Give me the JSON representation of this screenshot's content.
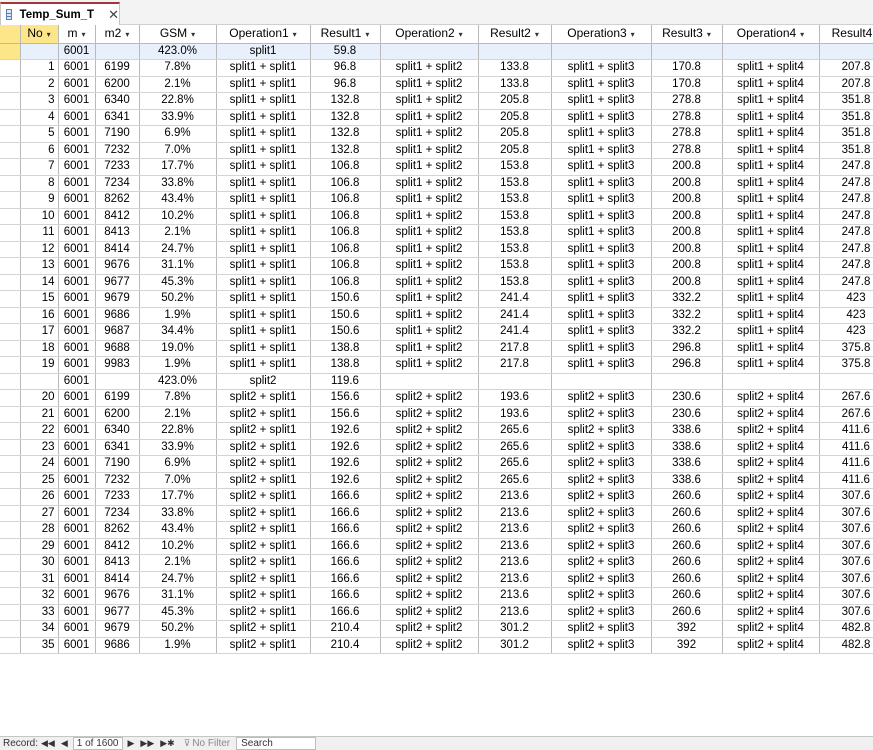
{
  "tab": {
    "title": "Temp_Sum_T",
    "close": "✕"
  },
  "columns": [
    {
      "key": "no",
      "label": "No"
    },
    {
      "key": "m",
      "label": "m"
    },
    {
      "key": "m2",
      "label": "m2"
    },
    {
      "key": "gsm",
      "label": "GSM"
    },
    {
      "key": "op1",
      "label": "Operation1"
    },
    {
      "key": "r1",
      "label": "Result1"
    },
    {
      "key": "op2",
      "label": "Operation2"
    },
    {
      "key": "r2",
      "label": "Result2"
    },
    {
      "key": "op3",
      "label": "Operation3"
    },
    {
      "key": "r3",
      "label": "Result3"
    },
    {
      "key": "op4",
      "label": "Operation4"
    },
    {
      "key": "r4",
      "label": "Result4"
    }
  ],
  "rows": [
    [
      "",
      "6001",
      "",
      "423.0%",
      "split1",
      "59.8",
      "",
      "",
      "",
      "",
      "",
      ""
    ],
    [
      "1",
      "6001",
      "6199",
      "7.8%",
      "split1 + split1",
      "96.8",
      "split1 + split2",
      "133.8",
      "split1 + split3",
      "170.8",
      "split1 + split4",
      "207.8"
    ],
    [
      "2",
      "6001",
      "6200",
      "2.1%",
      "split1 + split1",
      "96.8",
      "split1 + split2",
      "133.8",
      "split1 + split3",
      "170.8",
      "split1 + split4",
      "207.8"
    ],
    [
      "3",
      "6001",
      "6340",
      "22.8%",
      "split1 + split1",
      "132.8",
      "split1 + split2",
      "205.8",
      "split1 + split3",
      "278.8",
      "split1 + split4",
      "351.8"
    ],
    [
      "4",
      "6001",
      "6341",
      "33.9%",
      "split1 + split1",
      "132.8",
      "split1 + split2",
      "205.8",
      "split1 + split3",
      "278.8",
      "split1 + split4",
      "351.8"
    ],
    [
      "5",
      "6001",
      "7190",
      "6.9%",
      "split1 + split1",
      "132.8",
      "split1 + split2",
      "205.8",
      "split1 + split3",
      "278.8",
      "split1 + split4",
      "351.8"
    ],
    [
      "6",
      "6001",
      "7232",
      "7.0%",
      "split1 + split1",
      "132.8",
      "split1 + split2",
      "205.8",
      "split1 + split3",
      "278.8",
      "split1 + split4",
      "351.8"
    ],
    [
      "7",
      "6001",
      "7233",
      "17.7%",
      "split1 + split1",
      "106.8",
      "split1 + split2",
      "153.8",
      "split1 + split3",
      "200.8",
      "split1 + split4",
      "247.8"
    ],
    [
      "8",
      "6001",
      "7234",
      "33.8%",
      "split1 + split1",
      "106.8",
      "split1 + split2",
      "153.8",
      "split1 + split3",
      "200.8",
      "split1 + split4",
      "247.8"
    ],
    [
      "9",
      "6001",
      "8262",
      "43.4%",
      "split1 + split1",
      "106.8",
      "split1 + split2",
      "153.8",
      "split1 + split3",
      "200.8",
      "split1 + split4",
      "247.8"
    ],
    [
      "10",
      "6001",
      "8412",
      "10.2%",
      "split1 + split1",
      "106.8",
      "split1 + split2",
      "153.8",
      "split1 + split3",
      "200.8",
      "split1 + split4",
      "247.8"
    ],
    [
      "11",
      "6001",
      "8413",
      "2.1%",
      "split1 + split1",
      "106.8",
      "split1 + split2",
      "153.8",
      "split1 + split3",
      "200.8",
      "split1 + split4",
      "247.8"
    ],
    [
      "12",
      "6001",
      "8414",
      "24.7%",
      "split1 + split1",
      "106.8",
      "split1 + split2",
      "153.8",
      "split1 + split3",
      "200.8",
      "split1 + split4",
      "247.8"
    ],
    [
      "13",
      "6001",
      "9676",
      "31.1%",
      "split1 + split1",
      "106.8",
      "split1 + split2",
      "153.8",
      "split1 + split3",
      "200.8",
      "split1 + split4",
      "247.8"
    ],
    [
      "14",
      "6001",
      "9677",
      "45.3%",
      "split1 + split1",
      "106.8",
      "split1 + split2",
      "153.8",
      "split1 + split3",
      "200.8",
      "split1 + split4",
      "247.8"
    ],
    [
      "15",
      "6001",
      "9679",
      "50.2%",
      "split1 + split1",
      "150.6",
      "split1 + split2",
      "241.4",
      "split1 + split3",
      "332.2",
      "split1 + split4",
      "423"
    ],
    [
      "16",
      "6001",
      "9686",
      "1.9%",
      "split1 + split1",
      "150.6",
      "split1 + split2",
      "241.4",
      "split1 + split3",
      "332.2",
      "split1 + split4",
      "423"
    ],
    [
      "17",
      "6001",
      "9687",
      "34.4%",
      "split1 + split1",
      "150.6",
      "split1 + split2",
      "241.4",
      "split1 + split3",
      "332.2",
      "split1 + split4",
      "423"
    ],
    [
      "18",
      "6001",
      "9688",
      "19.0%",
      "split1 + split1",
      "138.8",
      "split1 + split2",
      "217.8",
      "split1 + split3",
      "296.8",
      "split1 + split4",
      "375.8"
    ],
    [
      "19",
      "6001",
      "9983",
      "1.9%",
      "split1 + split1",
      "138.8",
      "split1 + split2",
      "217.8",
      "split1 + split3",
      "296.8",
      "split1 + split4",
      "375.8"
    ],
    [
      "",
      "6001",
      "",
      "423.0%",
      "split2",
      "119.6",
      "",
      "",
      "",
      "",
      "",
      ""
    ],
    [
      "20",
      "6001",
      "6199",
      "7.8%",
      "split2 + split1",
      "156.6",
      "split2 + split2",
      "193.6",
      "split2 + split3",
      "230.6",
      "split2 + split4",
      "267.6"
    ],
    [
      "21",
      "6001",
      "6200",
      "2.1%",
      "split2 + split1",
      "156.6",
      "split2 + split2",
      "193.6",
      "split2 + split3",
      "230.6",
      "split2 + split4",
      "267.6"
    ],
    [
      "22",
      "6001",
      "6340",
      "22.8%",
      "split2 + split1",
      "192.6",
      "split2 + split2",
      "265.6",
      "split2 + split3",
      "338.6",
      "split2 + split4",
      "411.6"
    ],
    [
      "23",
      "6001",
      "6341",
      "33.9%",
      "split2 + split1",
      "192.6",
      "split2 + split2",
      "265.6",
      "split2 + split3",
      "338.6",
      "split2 + split4",
      "411.6"
    ],
    [
      "24",
      "6001",
      "7190",
      "6.9%",
      "split2 + split1",
      "192.6",
      "split2 + split2",
      "265.6",
      "split2 + split3",
      "338.6",
      "split2 + split4",
      "411.6"
    ],
    [
      "25",
      "6001",
      "7232",
      "7.0%",
      "split2 + split1",
      "192.6",
      "split2 + split2",
      "265.6",
      "split2 + split3",
      "338.6",
      "split2 + split4",
      "411.6"
    ],
    [
      "26",
      "6001",
      "7233",
      "17.7%",
      "split2 + split1",
      "166.6",
      "split2 + split2",
      "213.6",
      "split2 + split3",
      "260.6",
      "split2 + split4",
      "307.6"
    ],
    [
      "27",
      "6001",
      "7234",
      "33.8%",
      "split2 + split1",
      "166.6",
      "split2 + split2",
      "213.6",
      "split2 + split3",
      "260.6",
      "split2 + split4",
      "307.6"
    ],
    [
      "28",
      "6001",
      "8262",
      "43.4%",
      "split2 + split1",
      "166.6",
      "split2 + split2",
      "213.6",
      "split2 + split3",
      "260.6",
      "split2 + split4",
      "307.6"
    ],
    [
      "29",
      "6001",
      "8412",
      "10.2%",
      "split2 + split1",
      "166.6",
      "split2 + split2",
      "213.6",
      "split2 + split3",
      "260.6",
      "split2 + split4",
      "307.6"
    ],
    [
      "30",
      "6001",
      "8413",
      "2.1%",
      "split2 + split1",
      "166.6",
      "split2 + split2",
      "213.6",
      "split2 + split3",
      "260.6",
      "split2 + split4",
      "307.6"
    ],
    [
      "31",
      "6001",
      "8414",
      "24.7%",
      "split2 + split1",
      "166.6",
      "split2 + split2",
      "213.6",
      "split2 + split3",
      "260.6",
      "split2 + split4",
      "307.6"
    ],
    [
      "32",
      "6001",
      "9676",
      "31.1%",
      "split2 + split1",
      "166.6",
      "split2 + split2",
      "213.6",
      "split2 + split3",
      "260.6",
      "split2 + split4",
      "307.6"
    ],
    [
      "33",
      "6001",
      "9677",
      "45.3%",
      "split2 + split1",
      "166.6",
      "split2 + split2",
      "213.6",
      "split2 + split3",
      "260.6",
      "split2 + split4",
      "307.6"
    ],
    [
      "34",
      "6001",
      "9679",
      "50.2%",
      "split2 + split1",
      "210.4",
      "split2 + split2",
      "301.2",
      "split2 + split3",
      "392",
      "split2 + split4",
      "482.8"
    ],
    [
      "35",
      "6001",
      "9686",
      "1.9%",
      "split2 + split1",
      "210.4",
      "split2 + split2",
      "301.2",
      "split2 + split3",
      "392",
      "split2 + split4",
      "482.8"
    ]
  ],
  "navbar": {
    "record_label": "Record:",
    "first": "◀◀",
    "prev": "◀",
    "position": "1 of 1600",
    "next": "▶",
    "last": "▶▶",
    "new": "▶✱",
    "filter": "No Filter",
    "search": "Search"
  },
  "colors": {
    "accent": "#a4373a",
    "selected": "#fde68a",
    "grid": "#d4d4d4"
  }
}
